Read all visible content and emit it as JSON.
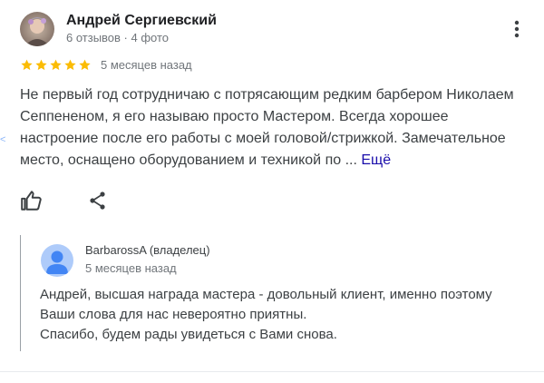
{
  "review": {
    "author": {
      "name": "Андрей Сергиевский",
      "meta": "6 отзывов · 4 фото"
    },
    "rating": {
      "stars": 5,
      "max": 5,
      "color": "#fbbc04"
    },
    "time": "5 месяцев назад",
    "text": "Не первый год сотрудничаю с потрясающим редким барбером Николаем Сеппененом, я его называю просто Мастером. Всегда хорошее настроение после его работы с моей головой/стрижкой. Замечательное место, оснащено оборудованием и техникой по ...",
    "more_label": "Ещё",
    "actions": {
      "like_icon": "thumbs-up-icon",
      "share_icon": "share-icon"
    },
    "menu_icon": "more-vert-icon"
  },
  "reply": {
    "owner_name": "BarbarossA (владелец)",
    "time": "5 месяцев назад",
    "lines": [
      "Андрей, высшая награда мастера - довольный клиент, именно поэтому",
      "Ваши слова для нас невероятно приятны.",
      "Спасибо, будем рады увидеться с Вами снова."
    ],
    "avatar_color": "#4285f4"
  },
  "edge_mark": "<"
}
